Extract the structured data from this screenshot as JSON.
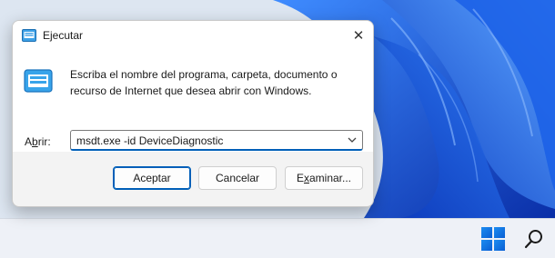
{
  "dialog": {
    "title": "Ejecutar",
    "message": "Escriba el nombre del programa, carpeta, documento o recurso de Internet que desea abrir con Windows.",
    "open_label_prefix": "A",
    "open_label_underlined": "b",
    "open_label_suffix": "rir:",
    "input_value": "msdt.exe -id DeviceDiagnostic",
    "buttons": {
      "ok": "Aceptar",
      "cancel": "Cancelar",
      "browse_prefix": "E",
      "browse_underlined": "x",
      "browse_suffix": "aminar..."
    },
    "close_glyph": "✕"
  },
  "taskbar": {
    "icons": [
      "start-icon",
      "search-icon"
    ]
  },
  "colors": {
    "accent": "#005fb8",
    "start_blue": "#1b8cf0",
    "wallpaper_blue": "#0a47c9"
  }
}
